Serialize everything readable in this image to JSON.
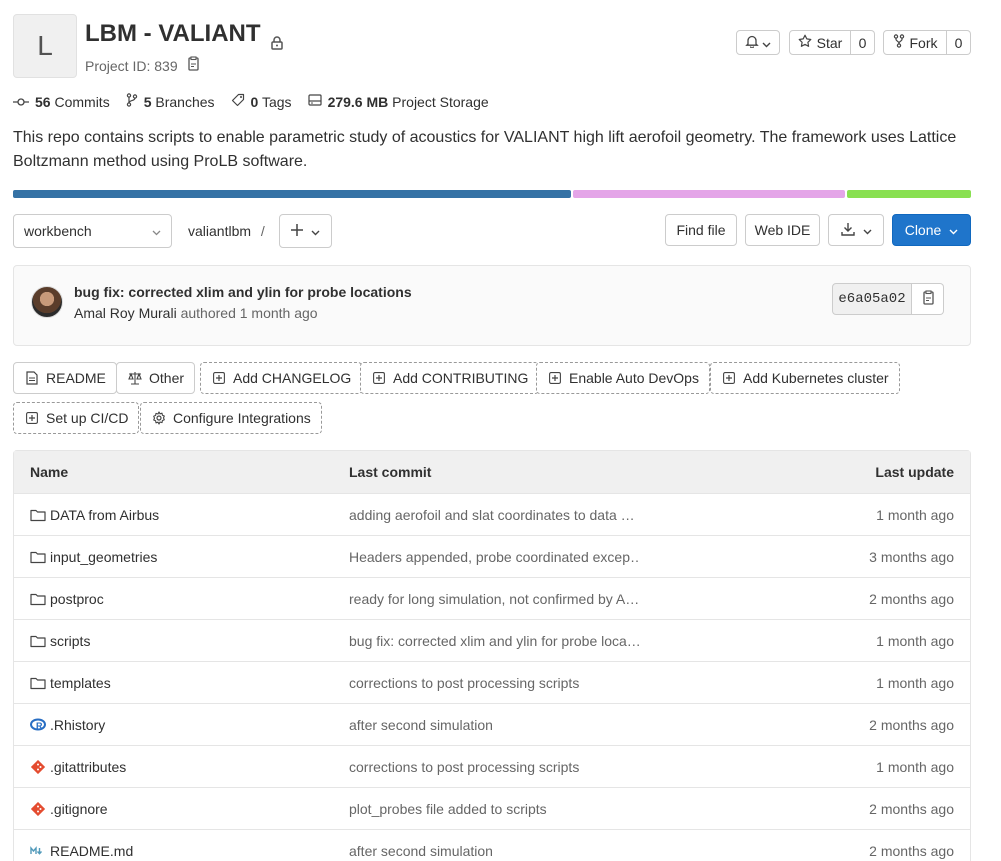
{
  "project": {
    "avatar_letter": "L",
    "title": "LBM - VALIANT",
    "id_label": "Project ID: 839",
    "description": "This repo contains scripts to enable parametric study of acoustics for VALIANT high lift aerofoil geometry. The framework uses Lattice Boltzmann method using ProLB software."
  },
  "actions": {
    "star_label": "Star",
    "star_count": "0",
    "fork_label": "Fork",
    "fork_count": "0"
  },
  "stats": {
    "commits_count": "56",
    "commits_label": "Commits",
    "branches_count": "5",
    "branches_label": "Branches",
    "tags_count": "0",
    "tags_label": "Tags",
    "storage_size": "279.6 MB",
    "storage_label": "Project Storage"
  },
  "languages": [
    {
      "color": "#3572a5",
      "fraction": 0.585
    },
    {
      "color": "#e4a5e8",
      "fraction": 0.285
    },
    {
      "color": "#89e051",
      "fraction": 0.13
    }
  ],
  "toolbar": {
    "branch": "workbench",
    "path": "valiantlbm",
    "path_sep": "/",
    "find_file": "Find file",
    "web_ide": "Web IDE",
    "clone": "Clone"
  },
  "commit": {
    "title": "bug fix: corrected xlim and ylin for probe locations",
    "author": "Amal Roy Murali",
    "meta": "authored 1 month ago",
    "sha": "e6a05a02"
  },
  "quick_buttons": [
    {
      "label": "README",
      "icon": "file-icon",
      "style": "solid"
    },
    {
      "label": "Other",
      "icon": "scale-icon",
      "style": "solid"
    },
    {
      "label": "Add CHANGELOG",
      "icon": "plus-square-icon",
      "style": "dashed"
    },
    {
      "label": "Add CONTRIBUTING",
      "icon": "plus-square-icon",
      "style": "dashed"
    },
    {
      "label": "Enable Auto DevOps",
      "icon": "plus-square-icon",
      "style": "dashed"
    },
    {
      "label": "Add Kubernetes cluster",
      "icon": "plus-square-icon",
      "style": "dashed"
    },
    {
      "label": "Set up CI/CD",
      "icon": "plus-square-icon",
      "style": "dashed"
    },
    {
      "label": "Configure Integrations",
      "icon": "settings-icon",
      "style": "dashed"
    }
  ],
  "table": {
    "headers": {
      "name": "Name",
      "last_commit": "Last commit",
      "last_update": "Last update"
    },
    "rows": [
      {
        "name": "DATA from Airbus",
        "icon": "folder-icon",
        "commit": "adding aerofoil and slat coordinates to data …",
        "updated": "1 month ago"
      },
      {
        "name": "input_geometries",
        "icon": "folder-icon",
        "commit": "Headers appended, probe coordinated excep…",
        "updated": "3 months ago"
      },
      {
        "name": "postproc",
        "icon": "folder-icon",
        "commit": "ready for long simulation, not confirmed by A…",
        "updated": "2 months ago"
      },
      {
        "name": "scripts",
        "icon": "folder-icon",
        "commit": "bug fix: corrected xlim and ylin for probe loca…",
        "updated": "1 month ago"
      },
      {
        "name": "templates",
        "icon": "folder-icon",
        "commit": "corrections to post processing scripts",
        "updated": "1 month ago"
      },
      {
        "name": ".Rhistory",
        "icon": "r-file-icon",
        "commit": "after second simulation",
        "updated": "2 months ago"
      },
      {
        "name": ".gitattributes",
        "icon": "git-file-icon",
        "commit": "corrections to post processing scripts",
        "updated": "1 month ago"
      },
      {
        "name": ".gitignore",
        "icon": "git-file-icon",
        "commit": "plot_probes file added to scripts",
        "updated": "2 months ago"
      },
      {
        "name": "README.md",
        "icon": "markdown-file-icon",
        "commit": "after second simulation",
        "updated": "2 months ago"
      }
    ]
  },
  "colors": {
    "primary": "#1f75cb",
    "text": "#303030",
    "muted": "#666666"
  }
}
